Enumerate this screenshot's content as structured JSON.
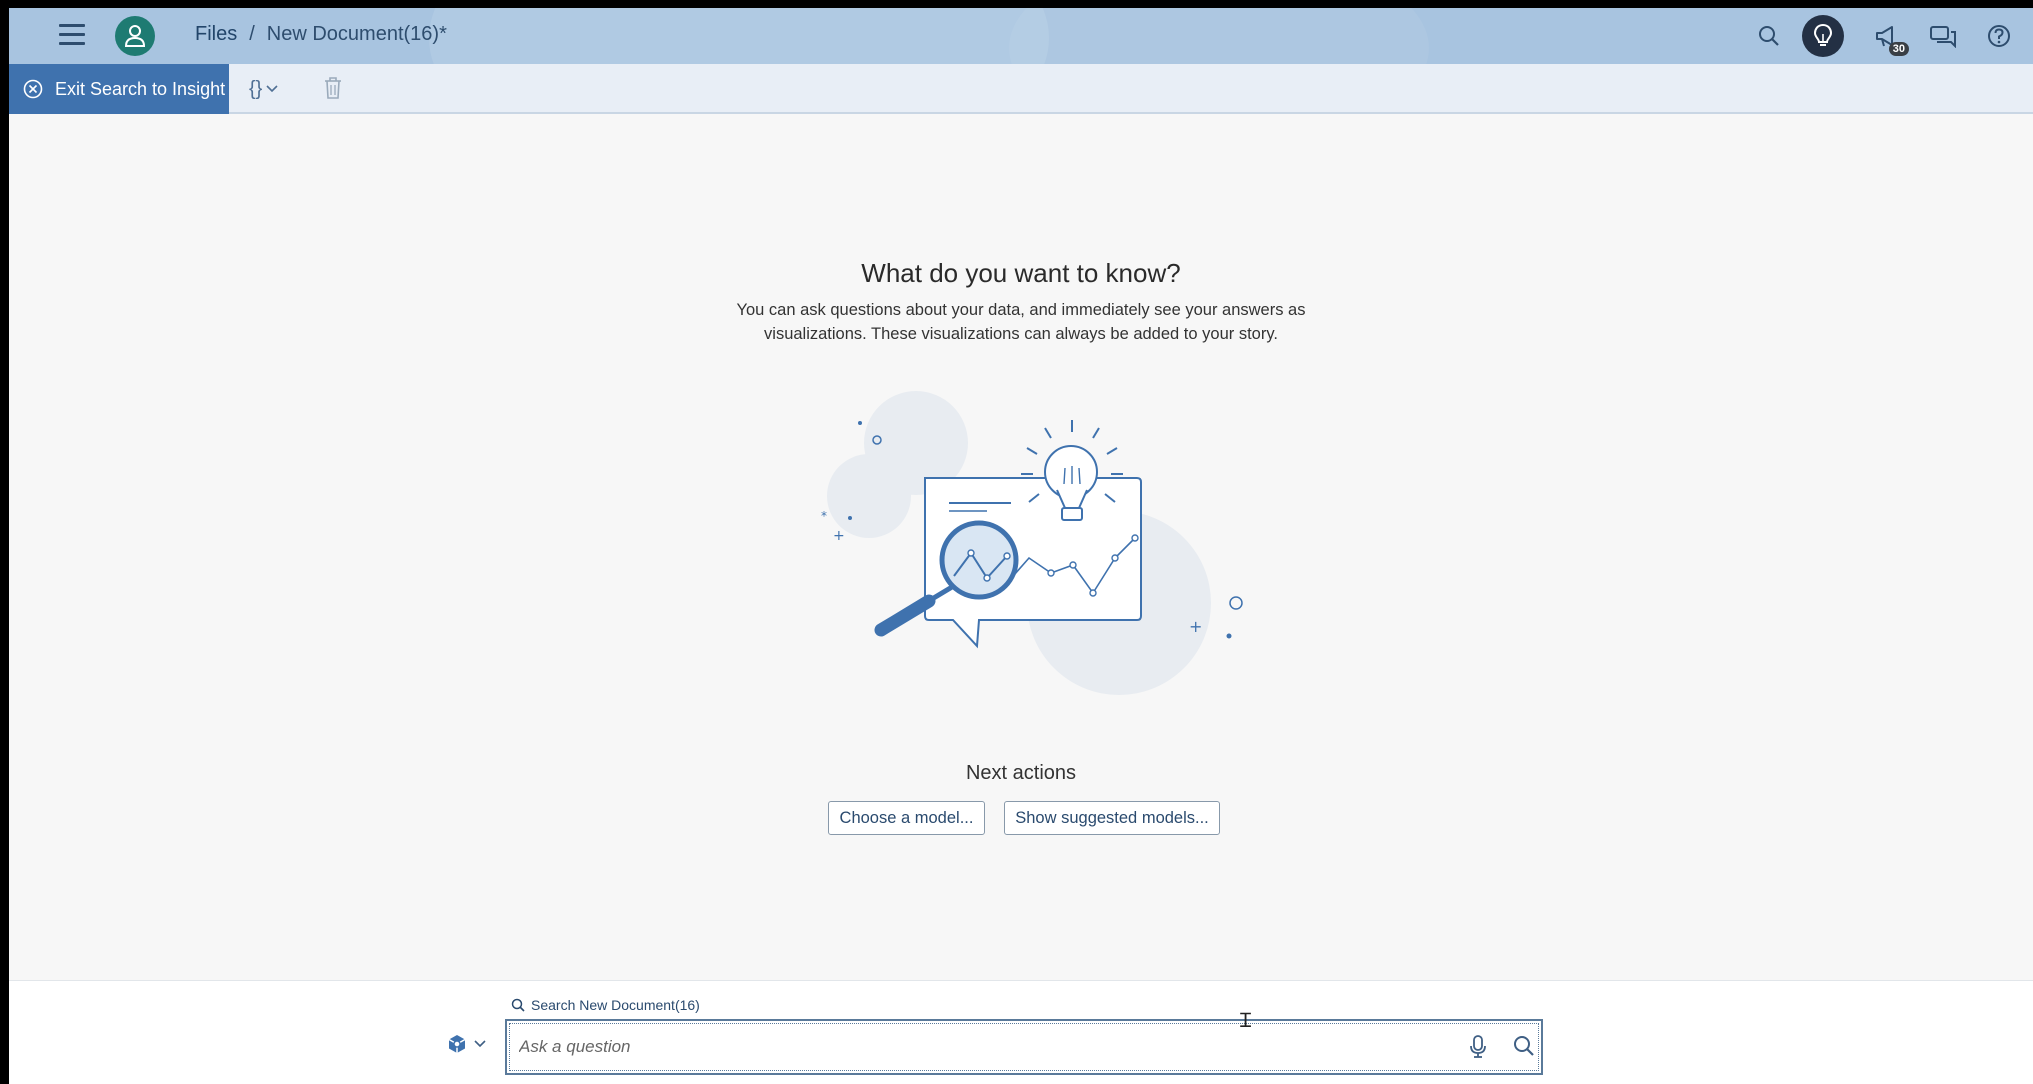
{
  "shell": {
    "breadcrumb": {
      "files": "Files",
      "separator": "/",
      "document": "New Document(16)*"
    },
    "notification_count": "30"
  },
  "toolbar": {
    "exit_label": "Exit Search to Insight",
    "curly_label": "{}"
  },
  "main": {
    "headline": "What do you want to know?",
    "description": "You can ask questions about your data, and immediately see your answers as visualizations. These visualizations can always be added to your story.",
    "next_actions": {
      "title": "Next actions",
      "choose_model": "Choose a model...",
      "show_suggested": "Show suggested models..."
    }
  },
  "search": {
    "label": "Search New Document(16)",
    "placeholder": "Ask a question"
  },
  "colors": {
    "shell_bar": "#a8c4e0",
    "accent": "#3f72ae",
    "avatar": "#1e7b72"
  }
}
